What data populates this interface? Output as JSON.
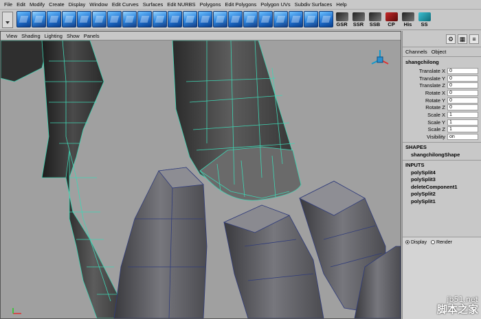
{
  "menu": [
    "File",
    "Edit",
    "Modify",
    "Create",
    "Display",
    "Window",
    "Edit Curves",
    "Surfaces",
    "Edit NURBS",
    "Polygons",
    "Edit Polygons",
    "Polygon UVs",
    "Subdiv Surfaces",
    "Help"
  ],
  "shelf": {
    "icons": [
      "poly-tool-icon",
      "poly-tool-icon",
      "poly-tool-icon",
      "poly-tool-icon",
      "poly-tool-icon",
      "poly-tool-icon",
      "poly-tool-icon",
      "poly-tool-icon",
      "poly-tool-icon",
      "poly-tool-icon",
      "poly-tool-icon",
      "poly-tool-icon",
      "poly-tool-icon",
      "poly-tool-icon",
      "poly-tool-icon",
      "poly-tool-icon",
      "poly-tool-icon",
      "poly-tool-icon",
      "poly-tool-icon",
      "poly-tool-icon",
      "poly-tool-icon"
    ],
    "text_buttons": [
      "GSR",
      "SSR",
      "SSB",
      "CP",
      "His",
      "SS"
    ]
  },
  "panel_menu": [
    "View",
    "Shading",
    "Lighting",
    "Show",
    "Panels"
  ],
  "channel_box": {
    "tabs": [
      "Channels",
      "Object"
    ],
    "object_name": "shangchilong",
    "attributes": [
      {
        "name": "Translate X",
        "value": "0"
      },
      {
        "name": "Translate Y",
        "value": "0"
      },
      {
        "name": "Translate Z",
        "value": "0"
      },
      {
        "name": "Rotate X",
        "value": "0"
      },
      {
        "name": "Rotate Y",
        "value": "0"
      },
      {
        "name": "Rotate Z",
        "value": "0"
      },
      {
        "name": "Scale X",
        "value": "1"
      },
      {
        "name": "Scale Y",
        "value": "1"
      },
      {
        "name": "Scale Z",
        "value": "1"
      },
      {
        "name": "Visibility",
        "value": "on"
      }
    ],
    "shapes_header": "SHAPES",
    "shape_name": "shangchilongShape",
    "inputs_header": "INPUTS",
    "inputs": [
      "polySplit4",
      "polySplit3",
      "deleteComponent1",
      "polySplit2",
      "polySplit1"
    ],
    "radio_labels": [
      "Display",
      "Render"
    ]
  },
  "watermark": {
    "line1": "jb51.net",
    "line2": "脚本之家"
  },
  "colors": {
    "ui_gray": "#c8c8c8",
    "viewport_bg": "#a0a0a0",
    "wireframe": "#3fd6b4",
    "shelf_blue": "#1e6fcf"
  }
}
